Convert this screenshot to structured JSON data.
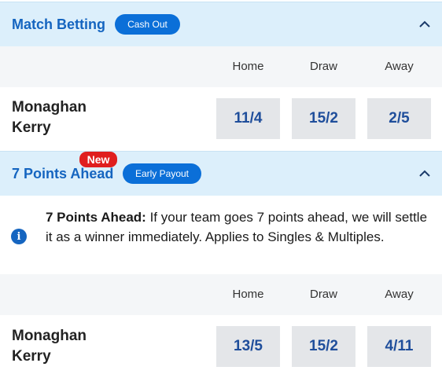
{
  "match_betting": {
    "title": "Match Betting",
    "badge": "Cash Out",
    "columns": [
      "Home",
      "Draw",
      "Away"
    ],
    "event": {
      "team1": "Monaghan",
      "team2": "Kerry",
      "odds": [
        "11/4",
        "15/2",
        "2/5"
      ]
    }
  },
  "points_ahead": {
    "new_badge": "New",
    "title": "7 Points Ahead",
    "badge": "Early Payout",
    "info_bold": "7 Points Ahead:",
    "info_text": " If your team goes 7 points ahead, we will settle it as a winner immediately. Applies to Singles & Multiples.",
    "columns": [
      "Home",
      "Draw",
      "Away"
    ],
    "event": {
      "team1": "Monaghan",
      "team2": "Kerry",
      "odds": [
        "13/5",
        "15/2",
        "4/11"
      ]
    }
  },
  "icons": {
    "collapse": "chevron-up-icon",
    "info": "info-icon"
  },
  "colors": {
    "header_bg": "#dceffb",
    "accent": "#0b6fd8",
    "title": "#1565c0",
    "odds_text": "#1f4e9b",
    "new_badge": "#e01e1e"
  }
}
